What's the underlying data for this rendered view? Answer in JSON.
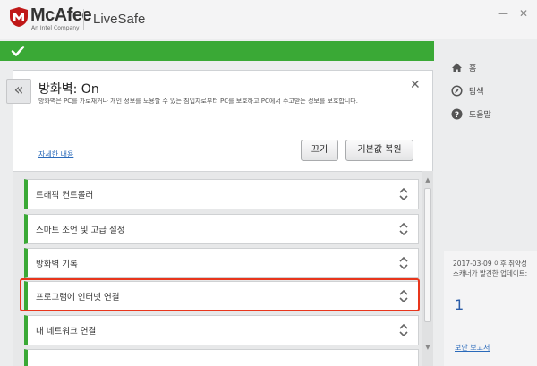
{
  "app": {
    "brand": "McAfee",
    "brand_sub": "An Intel Company",
    "product": "LiveSafe",
    "minimize_glyph": "—",
    "close_glyph": "✕"
  },
  "status": {
    "icon": "checkmark-icon",
    "color": "#3aa936"
  },
  "nav": {
    "items": [
      {
        "label": "홈",
        "icon": "home-icon"
      },
      {
        "label": "탐색",
        "icon": "compass-icon"
      },
      {
        "label": "도움말",
        "icon": "help-icon"
      }
    ]
  },
  "notice": {
    "text": "2017-03-09 이후 취약성 스캐너가 발견한 업데이트:",
    "count": "1",
    "link": "보안 보고서"
  },
  "panel": {
    "back_glyph": "«",
    "title": "방화벽: On",
    "close_glyph": "✕",
    "description": "방화벽은 PC를 가로채거나 개인 정보를 도용할 수 있는 침입자로부터 PC를 보호하고 PC에서 주고받는 정보를 보호합니다.",
    "details_link": "자세한 내용",
    "off_button": "끄기",
    "reset_button": "기본값 복원"
  },
  "list": {
    "items": [
      {
        "label": "트래픽 컨트롤러"
      },
      {
        "label": "스마트 조언 및 고급 설정"
      },
      {
        "label": "방화벽 기록"
      },
      {
        "label": "프로그램에 인터넷 연결"
      },
      {
        "label": "내 네트워크 연결"
      }
    ],
    "highlighted_index": 3,
    "highlight_color": "#e8361c"
  },
  "scroll": {
    "up_glyph": "▲",
    "down_glyph": "▼"
  }
}
